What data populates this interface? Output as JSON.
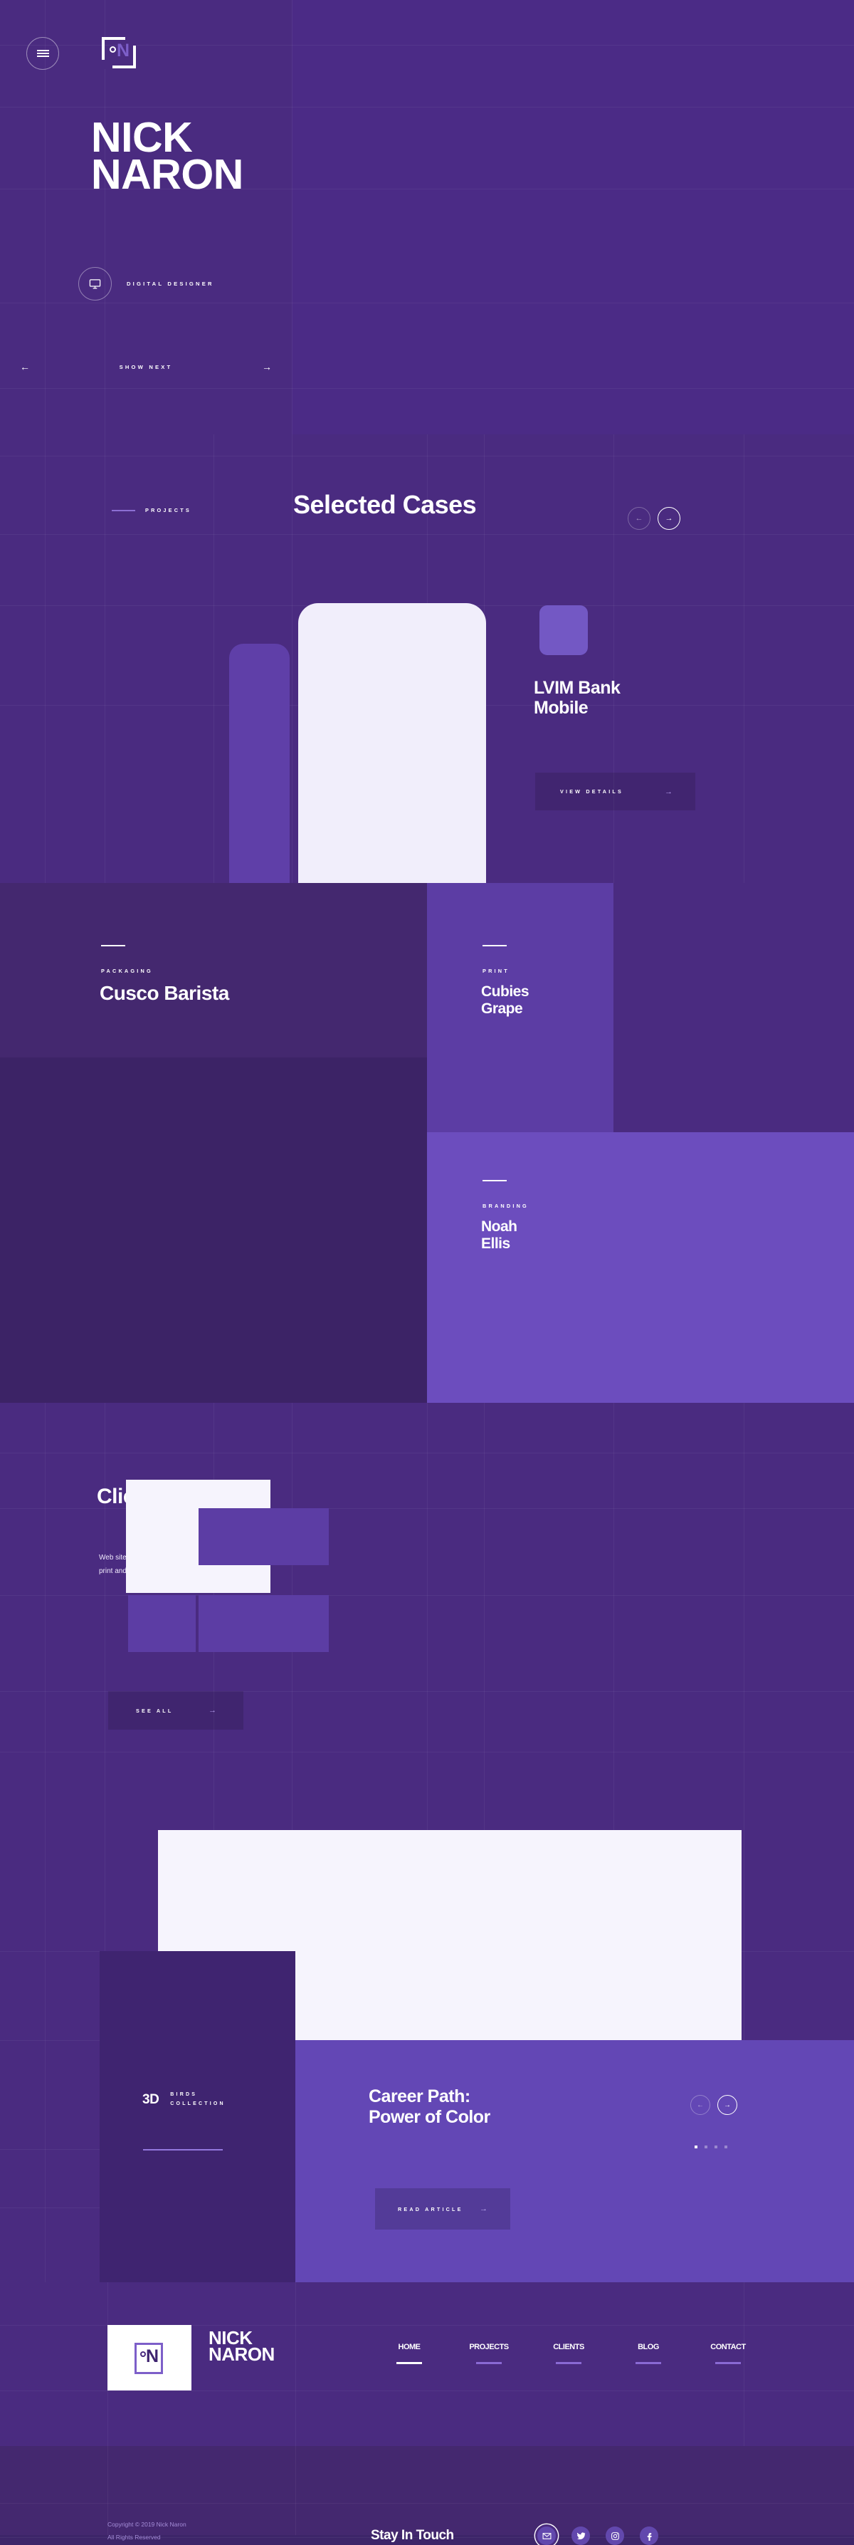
{
  "brand": {
    "name_line1": "NICK",
    "name_line2": "NARON",
    "logo_letter": "N"
  },
  "header": {
    "menu_icon": "hamburger-icon",
    "logo_icon": "nick-naron-logo-icon"
  },
  "hero": {
    "name_line1": "NICK",
    "name_line2": "NARON",
    "role": "DIGITAL DESIGNER",
    "role_icon": "monitor-icon",
    "prev_arrow": "←",
    "next_arrow": "→",
    "show_next": "SHOW NEXT"
  },
  "cases": {
    "eyebrow": "PROJECTS",
    "title": "Selected Cases",
    "prev_arrow": "←",
    "next_arrow": "→",
    "featured": {
      "title_line1": "LVIM Bank",
      "title_line2": "Mobile",
      "button_label": "VIEW DETAILS",
      "button_arrow": "→"
    }
  },
  "projects": [
    {
      "category": "PACKAGING",
      "title_line1": "Cusco Barista",
      "title_line2": ""
    },
    {
      "category": "PRINT",
      "title_line1": "Cubies",
      "title_line2": "Grape"
    },
    {
      "category": "BRANDING",
      "title_line1": "Noah",
      "title_line2": "Ellis"
    }
  ],
  "clients": {
    "title": "Clients",
    "subtitle_line1": "Web site design, mobile apps,",
    "subtitle_line2": "print and more!",
    "button_label": "SEE ALL",
    "button_arrow": "→",
    "tiles": 6
  },
  "article": {
    "collection_number": "3D",
    "collection_line1": "BIRDS",
    "collection_line2": "COLLECTION",
    "title_line1": "Career Path:",
    "title_line2": "Power of Color",
    "button_label": "READ ARTICLE",
    "button_arrow": "→",
    "prev_arrow": "←",
    "next_arrow": "→",
    "dots_total": 4,
    "dots_active": 1
  },
  "footer": {
    "name_line1": "NICK",
    "name_line2": "NARON",
    "nav": [
      {
        "label": "HOME",
        "active": true
      },
      {
        "label": "PROJECTS",
        "active": false
      },
      {
        "label": "CLIENTS",
        "active": false
      },
      {
        "label": "BLOG",
        "active": false
      },
      {
        "label": "CONTACT",
        "active": false
      }
    ]
  },
  "bottom": {
    "copyright_line1": "Copyright © 2019 Nick Naron",
    "copyright_line2": "All Rights Reserved",
    "stay_in_touch": "Stay In Touch",
    "socials": [
      "mail-icon",
      "twitter-icon",
      "instagram-icon",
      "facebook-icon"
    ]
  },
  "colors": {
    "base_purple": "#4a2b80",
    "deep_purple": "#3f2470",
    "mid_purple": "#5c3da4",
    "light_purple": "#6c4dbe",
    "accent": "#7358c4",
    "off_white": "#f1eefb"
  }
}
